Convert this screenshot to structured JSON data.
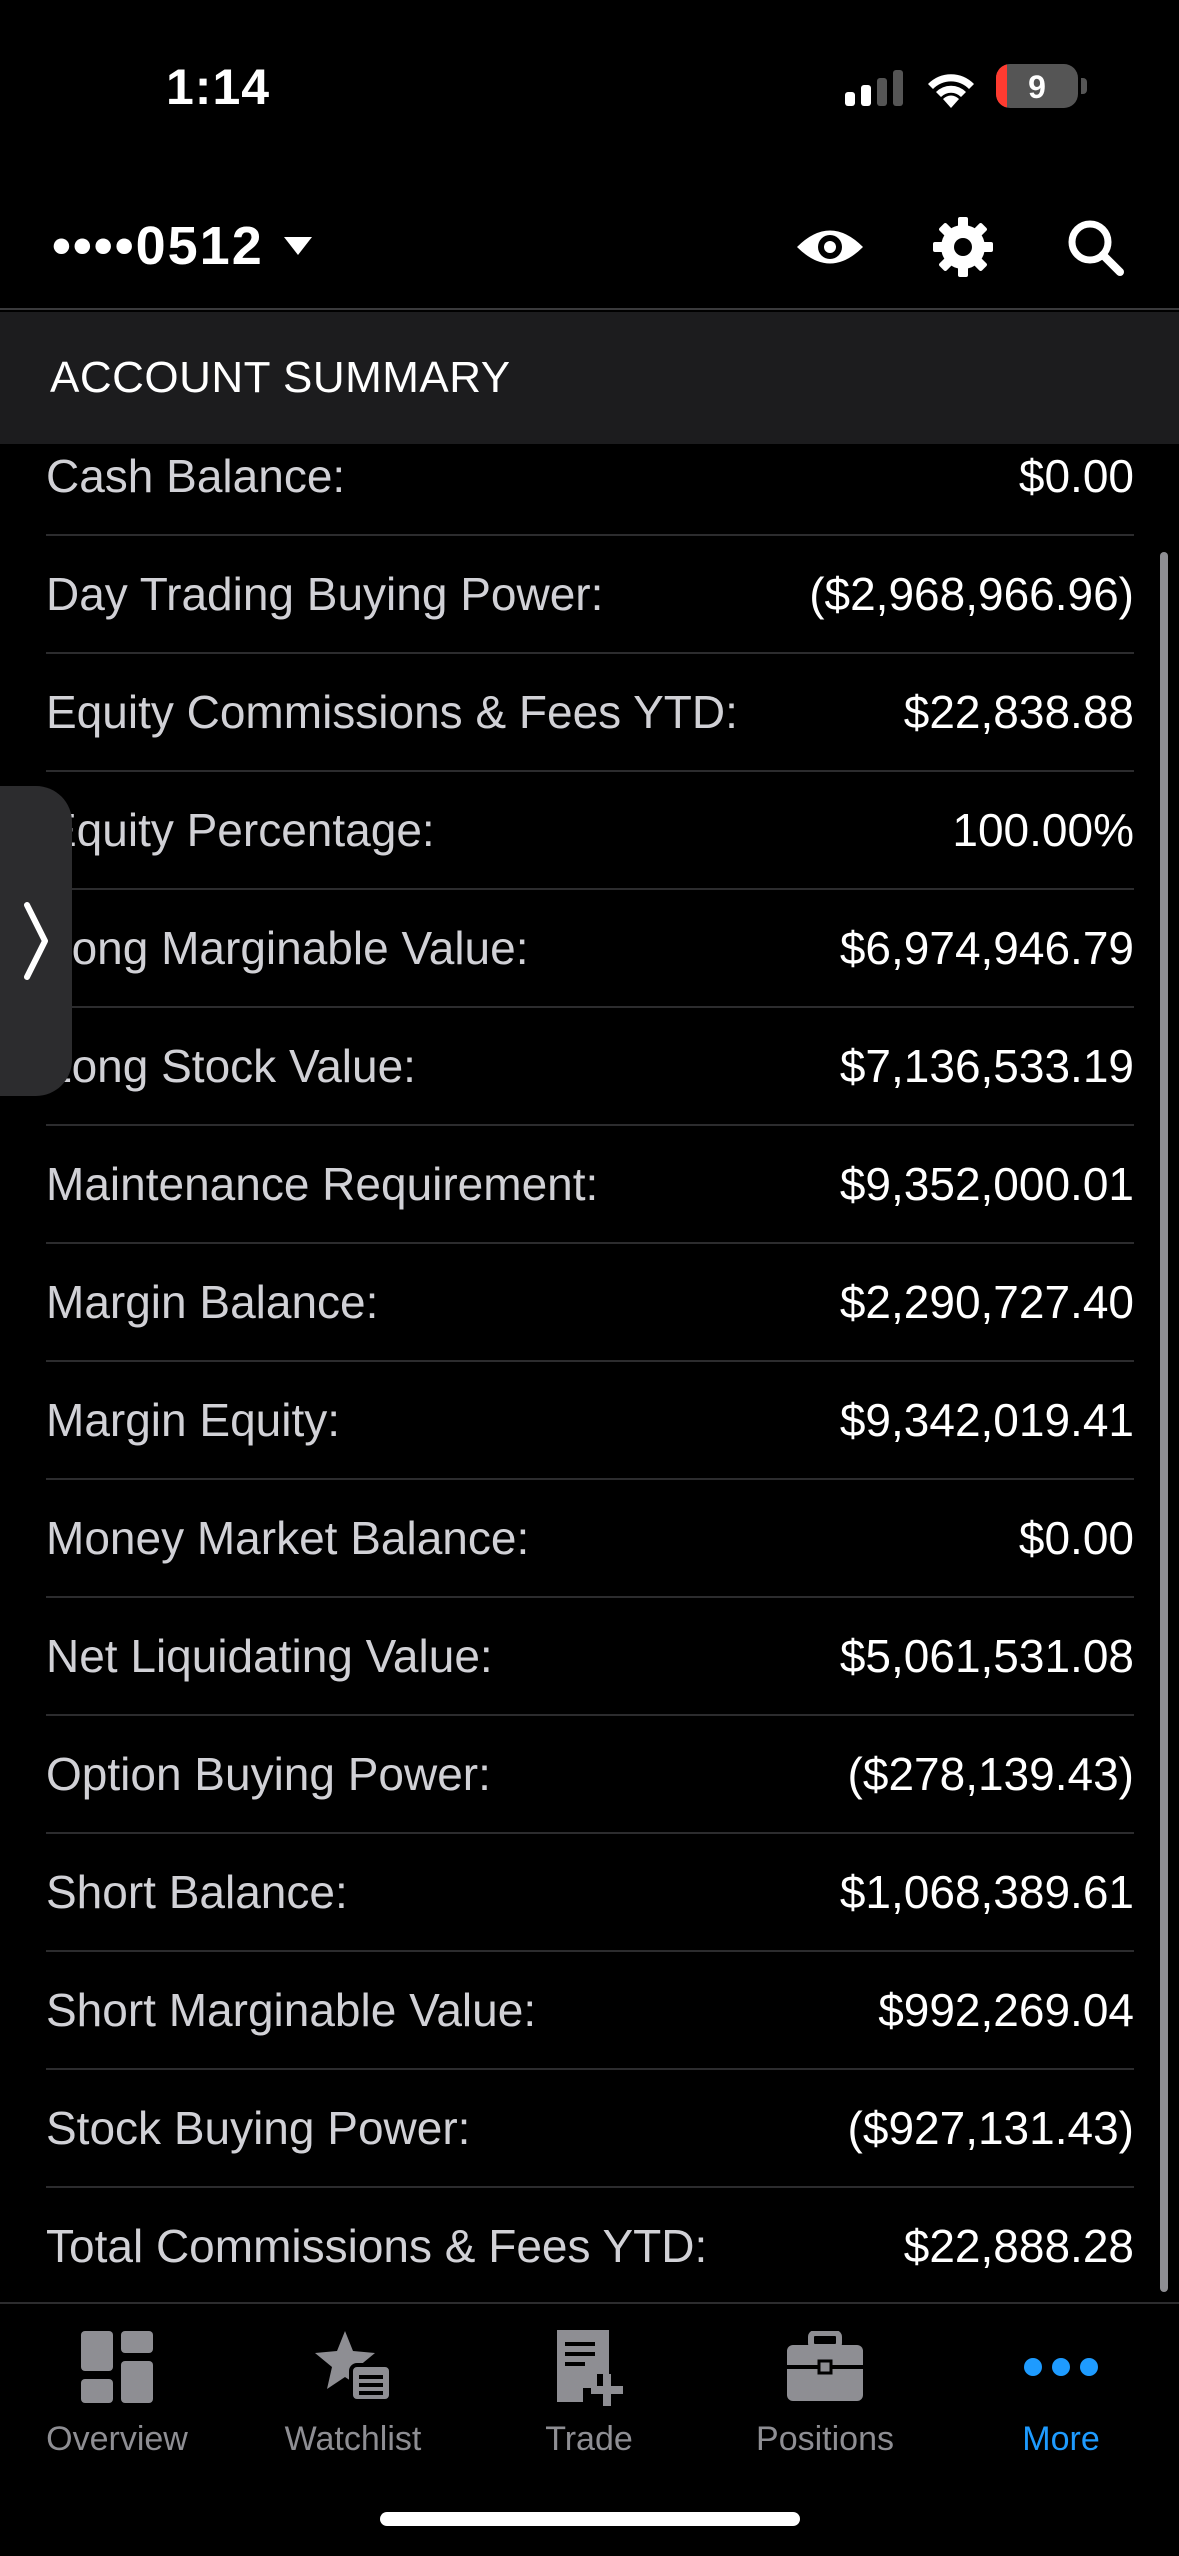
{
  "status_bar": {
    "time": "1:14",
    "battery_level": "9"
  },
  "header": {
    "account_masked": "••••0512"
  },
  "section": {
    "title": "ACCOUNT SUMMARY"
  },
  "rows": [
    {
      "label": "Cash Balance:",
      "value": "$0.00"
    },
    {
      "label": "Day Trading Buying Power:",
      "value": "($2,968,966.96)"
    },
    {
      "label": "Equity Commissions & Fees YTD:",
      "value": "$22,838.88"
    },
    {
      "label": "Equity Percentage:",
      "value": "100.00%"
    },
    {
      "label": "Long Marginable Value:",
      "value": "$6,974,946.79"
    },
    {
      "label": "Long Stock Value:",
      "value": "$7,136,533.19"
    },
    {
      "label": "Maintenance Requirement:",
      "value": "$9,352,000.01"
    },
    {
      "label": "Margin Balance:",
      "value": "$2,290,727.40"
    },
    {
      "label": "Margin Equity:",
      "value": "$9,342,019.41"
    },
    {
      "label": "Money Market Balance:",
      "value": "$0.00"
    },
    {
      "label": "Net Liquidating Value:",
      "value": "$5,061,531.08"
    },
    {
      "label": "Option Buying Power:",
      "value": "($278,139.43)"
    },
    {
      "label": "Short Balance:",
      "value": "$1,068,389.61"
    },
    {
      "label": "Short Marginable Value:",
      "value": "$992,269.04"
    },
    {
      "label": "Stock Buying Power:",
      "value": "($927,131.43)"
    },
    {
      "label": "Total Commissions & Fees YTD:",
      "value": "$22,888.28"
    }
  ],
  "tabs": [
    {
      "label": "Overview",
      "icon": "overview-icon",
      "active": false
    },
    {
      "label": "Watchlist",
      "icon": "watchlist-icon",
      "active": false
    },
    {
      "label": "Trade",
      "icon": "trade-icon",
      "active": false
    },
    {
      "label": "Positions",
      "icon": "positions-icon",
      "active": false
    },
    {
      "label": "More",
      "icon": "more-icon",
      "active": true
    }
  ],
  "colors": {
    "accent": "#1e9bff",
    "background": "#000000",
    "section_bg": "#1c1c1e",
    "battery_low": "#ff3b30"
  }
}
